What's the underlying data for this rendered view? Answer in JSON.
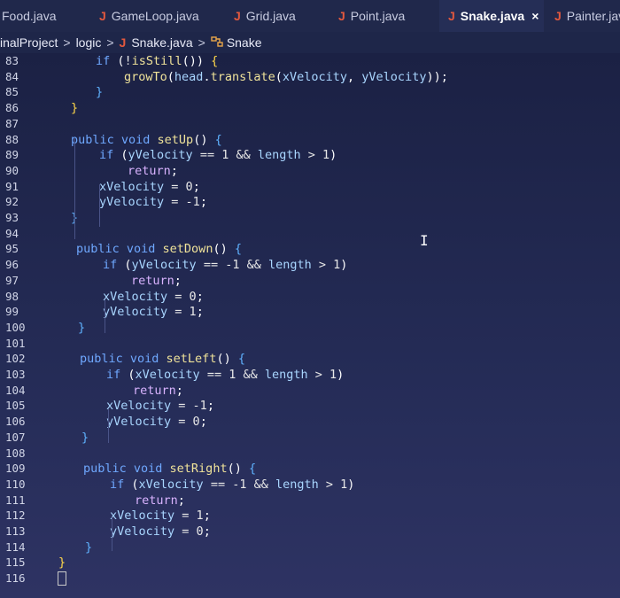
{
  "tabs": [
    {
      "label": "Food.java",
      "icon": "java-file-icon"
    },
    {
      "label": "GameLoop.java",
      "icon": "java-file-icon"
    },
    {
      "label": "Grid.java",
      "icon": "java-file-icon"
    },
    {
      "label": "Point.java",
      "icon": "java-file-icon"
    },
    {
      "label": "Snake.java",
      "icon": "java-file-icon",
      "close": "×"
    },
    {
      "label": "Painter.jav",
      "icon": "java-file-icon"
    }
  ],
  "breadcrumb": {
    "project": "inalProject",
    "package": "logic",
    "file": "Snake.java",
    "symbol": "Snake",
    "sep": ">"
  },
  "java_glyph": "J",
  "lines": [
    {
      "n": "83",
      "parts": [
        [
          "kw",
          "if "
        ],
        [
          "pl",
          "("
        ],
        [
          "op",
          "!"
        ],
        [
          "fn",
          "isStill"
        ],
        [
          "pl",
          "()) "
        ],
        [
          "brY",
          "{"
        ]
      ]
    },
    {
      "n": "84",
      "parts": [
        [
          "fn",
          "growTo"
        ],
        [
          "pl",
          "("
        ],
        [
          "var",
          "head"
        ],
        [
          "pl",
          "."
        ],
        [
          "fn",
          "translate"
        ],
        [
          "pl",
          "("
        ],
        [
          "var",
          "xVelocity"
        ],
        [
          "pl",
          ", "
        ],
        [
          "var",
          "yVelocity"
        ],
        [
          "pl",
          "));"
        ]
      ]
    },
    {
      "n": "85",
      "parts": [
        [
          "br",
          "}"
        ]
      ]
    },
    {
      "n": "86",
      "parts": [
        [
          "brY",
          "}"
        ]
      ]
    },
    {
      "n": "87",
      "parts": []
    },
    {
      "n": "88",
      "parts": [
        [
          "kw",
          "public void "
        ],
        [
          "fn",
          "setUp"
        ],
        [
          "pl",
          "() "
        ],
        [
          "br",
          "{"
        ]
      ]
    },
    {
      "n": "89",
      "parts": [
        [
          "kw",
          "if "
        ],
        [
          "pl",
          "("
        ],
        [
          "var",
          "yVelocity"
        ],
        [
          "op",
          " == "
        ],
        [
          "num",
          "1"
        ],
        [
          "op",
          " && "
        ],
        [
          "var",
          "length"
        ],
        [
          "op",
          " > "
        ],
        [
          "num",
          "1"
        ],
        [
          "pl",
          ")"
        ]
      ]
    },
    {
      "n": "90",
      "parts": [
        [
          "ret",
          "return"
        ],
        [
          "pl",
          ";"
        ]
      ]
    },
    {
      "n": "91",
      "parts": [
        [
          "var",
          "xVelocity"
        ],
        [
          "op",
          " = "
        ],
        [
          "num",
          "0"
        ],
        [
          "pl",
          ";"
        ]
      ]
    },
    {
      "n": "92",
      "parts": [
        [
          "var",
          "yVelocity"
        ],
        [
          "op",
          " = "
        ],
        [
          "num",
          "-1"
        ],
        [
          "pl",
          ";"
        ]
      ]
    },
    {
      "n": "93",
      "parts": [
        [
          "br",
          "}"
        ]
      ]
    },
    {
      "n": "94",
      "parts": []
    },
    {
      "n": "95",
      "parts": [
        [
          "kw",
          "public void "
        ],
        [
          "fn",
          "setDown"
        ],
        [
          "pl",
          "() "
        ],
        [
          "br",
          "{"
        ]
      ]
    },
    {
      "n": "96",
      "parts": [
        [
          "kw",
          "if "
        ],
        [
          "pl",
          "("
        ],
        [
          "var",
          "yVelocity"
        ],
        [
          "op",
          " == "
        ],
        [
          "num",
          "-1"
        ],
        [
          "op",
          " && "
        ],
        [
          "var",
          "length"
        ],
        [
          "op",
          " > "
        ],
        [
          "num",
          "1"
        ],
        [
          "pl",
          ")"
        ]
      ]
    },
    {
      "n": "97",
      "parts": [
        [
          "ret",
          "return"
        ],
        [
          "pl",
          ";"
        ]
      ]
    },
    {
      "n": "98",
      "parts": [
        [
          "var",
          "xVelocity"
        ],
        [
          "op",
          " = "
        ],
        [
          "num",
          "0"
        ],
        [
          "pl",
          ";"
        ]
      ]
    },
    {
      "n": "99",
      "parts": [
        [
          "var",
          "yVelocity"
        ],
        [
          "op",
          " = "
        ],
        [
          "num",
          "1"
        ],
        [
          "pl",
          ";"
        ]
      ]
    },
    {
      "n": "100",
      "parts": [
        [
          "br",
          "}"
        ]
      ]
    },
    {
      "n": "101",
      "parts": []
    },
    {
      "n": "102",
      "parts": [
        [
          "kw",
          "public void "
        ],
        [
          "fn",
          "setLeft"
        ],
        [
          "pl",
          "() "
        ],
        [
          "br",
          "{"
        ]
      ]
    },
    {
      "n": "103",
      "parts": [
        [
          "kw",
          "if "
        ],
        [
          "pl",
          "("
        ],
        [
          "var",
          "xVelocity"
        ],
        [
          "op",
          " == "
        ],
        [
          "num",
          "1"
        ],
        [
          "op",
          " && "
        ],
        [
          "var",
          "length"
        ],
        [
          "op",
          " > "
        ],
        [
          "num",
          "1"
        ],
        [
          "pl",
          ")"
        ]
      ]
    },
    {
      "n": "104",
      "parts": [
        [
          "ret",
          "return"
        ],
        [
          "pl",
          ";"
        ]
      ]
    },
    {
      "n": "105",
      "parts": [
        [
          "var",
          "xVelocity"
        ],
        [
          "op",
          " = "
        ],
        [
          "num",
          "-1"
        ],
        [
          "pl",
          ";"
        ]
      ]
    },
    {
      "n": "106",
      "parts": [
        [
          "var",
          "yVelocity"
        ],
        [
          "op",
          " = "
        ],
        [
          "num",
          "0"
        ],
        [
          "pl",
          ";"
        ]
      ]
    },
    {
      "n": "107",
      "parts": [
        [
          "br",
          "}"
        ]
      ]
    },
    {
      "n": "108",
      "parts": []
    },
    {
      "n": "109",
      "parts": [
        [
          "kw",
          "public void "
        ],
        [
          "fn",
          "setRight"
        ],
        [
          "pl",
          "() "
        ],
        [
          "br",
          "{"
        ]
      ]
    },
    {
      "n": "110",
      "parts": [
        [
          "kw",
          "if "
        ],
        [
          "pl",
          "("
        ],
        [
          "var",
          "xVelocity"
        ],
        [
          "op",
          " == "
        ],
        [
          "num",
          "-1"
        ],
        [
          "op",
          " && "
        ],
        [
          "var",
          "length"
        ],
        [
          "op",
          " > "
        ],
        [
          "num",
          "1"
        ],
        [
          "pl",
          ")"
        ]
      ]
    },
    {
      "n": "111",
      "parts": [
        [
          "ret",
          "return"
        ],
        [
          "pl",
          ";"
        ]
      ]
    },
    {
      "n": "112",
      "parts": [
        [
          "var",
          "xVelocity"
        ],
        [
          "op",
          " = "
        ],
        [
          "num",
          "1"
        ],
        [
          "pl",
          ";"
        ]
      ]
    },
    {
      "n": "113",
      "parts": [
        [
          "var",
          "yVelocity"
        ],
        [
          "op",
          " = "
        ],
        [
          "num",
          "0"
        ],
        [
          "pl",
          ";"
        ]
      ]
    },
    {
      "n": "114",
      "parts": [
        [
          "br",
          "}"
        ]
      ]
    },
    {
      "n": "115",
      "parts": [
        [
          "brY",
          "}"
        ]
      ]
    },
    {
      "n": "116",
      "parts": []
    }
  ],
  "cursor_glyph": "I"
}
